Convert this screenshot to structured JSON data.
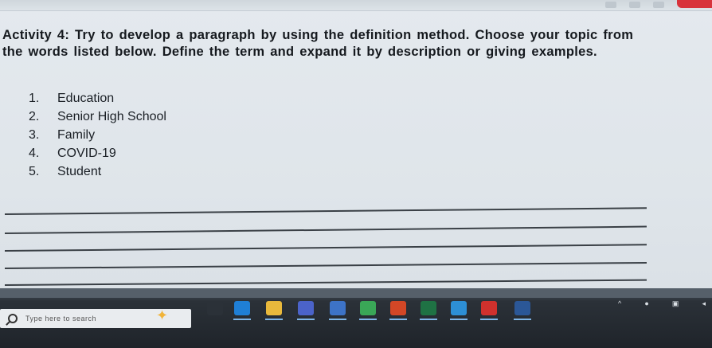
{
  "document": {
    "heading": "Activity 4: Try to develop a paragraph by using the definition method. Choose your topic from the words listed below. Define the term and expand it by description or giving examples.",
    "topics": [
      {
        "num": "1.",
        "label": "Education"
      },
      {
        "num": "2.",
        "label": "Senior High School"
      },
      {
        "num": "3.",
        "label": "Family"
      },
      {
        "num": "4.",
        "label": "COVID-19"
      },
      {
        "num": "5.",
        "label": "Student"
      }
    ]
  },
  "taskbar": {
    "search_placeholder": "Type here to search",
    "icons": [
      {
        "name": "task-view-icon",
        "color": "#2b3138"
      },
      {
        "name": "edge-icon",
        "color": "#1f7fd6"
      },
      {
        "name": "file-explorer-icon",
        "color": "#e9b93c"
      },
      {
        "name": "teams-icon",
        "color": "#4b63c9"
      },
      {
        "name": "store-icon",
        "color": "#3d73c7"
      },
      {
        "name": "chrome-icon",
        "color": "#3aa757"
      },
      {
        "name": "powerpoint-icon",
        "color": "#d24726"
      },
      {
        "name": "excel-icon",
        "color": "#1f7244"
      },
      {
        "name": "media-player-icon",
        "color": "#2d8fd5"
      },
      {
        "name": "acrobat-icon",
        "color": "#d0312d"
      },
      {
        "name": "word-icon",
        "color": "#2b5797"
      }
    ]
  }
}
